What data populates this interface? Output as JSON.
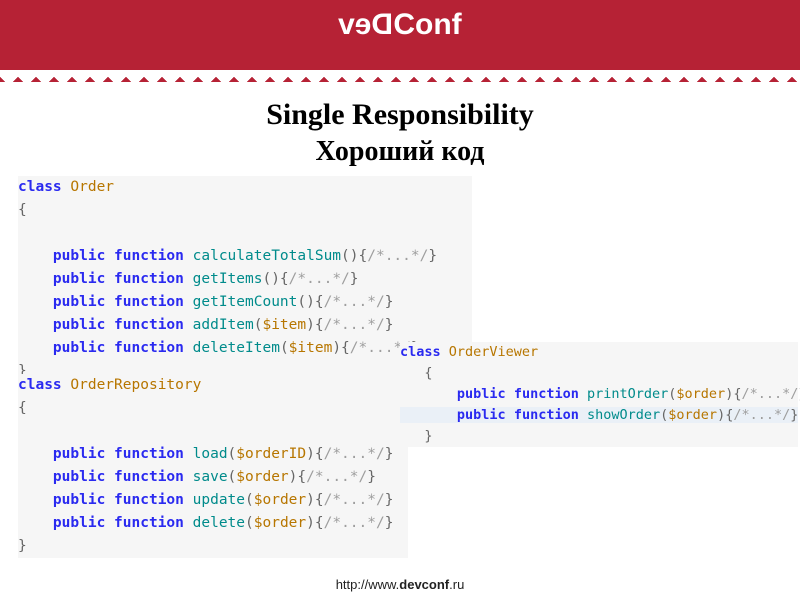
{
  "header": {
    "logo_left": "Dev",
    "logo_right": "Conf"
  },
  "title": "Single Responsibility",
  "subtitle": "Хороший код",
  "tokens": {
    "kw_class": "class",
    "kw_public": "public",
    "kw_function": "function",
    "comment": "/*...*/",
    "obrace": "{",
    "cbrace": "}",
    "op": "(",
    "cp": ")"
  },
  "code": {
    "order": {
      "name": "Order",
      "methods": [
        {
          "name": "calculateTotalSum",
          "params": []
        },
        {
          "name": "getItems",
          "params": []
        },
        {
          "name": "getItemCount",
          "params": []
        },
        {
          "name": "addItem",
          "params": [
            "$item"
          ]
        },
        {
          "name": "deleteItem",
          "params": [
            "$item"
          ]
        }
      ]
    },
    "repo": {
      "name": "OrderRepository",
      "methods": [
        {
          "name": "load",
          "params": [
            "$orderID"
          ]
        },
        {
          "name": "save",
          "params": [
            "$order"
          ]
        },
        {
          "name": "update",
          "params": [
            "$order"
          ]
        },
        {
          "name": "delete",
          "params": [
            "$order"
          ]
        }
      ]
    },
    "viewer": {
      "name": "OrderViewer",
      "methods": [
        {
          "name": "printOrder",
          "params": [
            "$order"
          ]
        },
        {
          "name": "showOrder",
          "params": [
            "$order"
          ],
          "highlight": true
        }
      ]
    }
  },
  "footer": {
    "pre": "http://www.",
    "bold": "devconf",
    "post": ".ru"
  }
}
